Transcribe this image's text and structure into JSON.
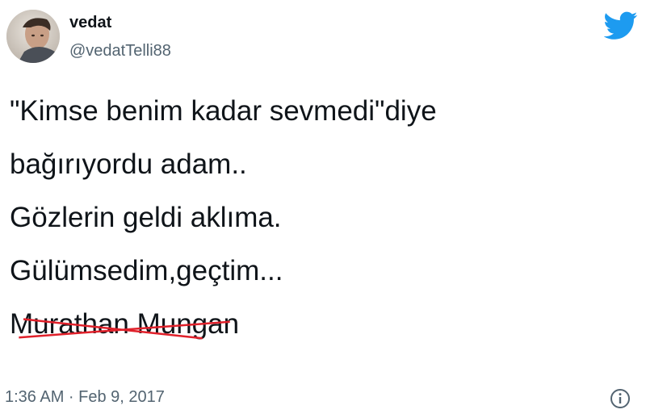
{
  "user": {
    "display_name": "vedat",
    "handle": "@vedatTelli88"
  },
  "tweet": {
    "lines": [
      "\"Kimse benim kadar sevmedi\"diye",
      "bağırıyordu adam..",
      "Gözlerin geldi aklıma.",
      "Gülümsedim,geçtim..."
    ],
    "struck_author": "Murathan Mungan",
    "timestamp": "1:36 AM · Feb 9, 2017"
  },
  "icons": {
    "brand": "twitter-bird-icon",
    "info": "info-icon"
  },
  "colors": {
    "twitter_blue": "#1d9bf0",
    "strike_red": "#e0202a",
    "secondary_text": "#536471",
    "primary_text": "#0f1419"
  }
}
